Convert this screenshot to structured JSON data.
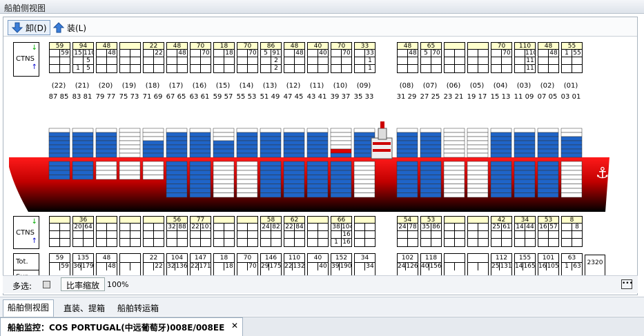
{
  "window": {
    "title": "船舶侧视图"
  },
  "toolbar": {
    "discharge_label": "卸(D)",
    "load_label": "装(L)"
  },
  "side": {
    "ctns": "CTNS",
    "tot": "Tot.",
    "sur": "Sur."
  },
  "bay_labels": [
    {
      "num": "(22)",
      "pair": "87 85"
    },
    {
      "num": "(21)",
      "pair": "83 81"
    },
    {
      "num": "(20)",
      "pair": "79 77"
    },
    {
      "num": "(19)",
      "pair": "75 73"
    },
    {
      "num": "(18)",
      "pair": "71 69"
    },
    {
      "num": "(17)",
      "pair": "67 65"
    },
    {
      "num": "(16)",
      "pair": "63 61"
    },
    {
      "num": "(15)",
      "pair": "59 57"
    },
    {
      "num": "(14)",
      "pair": "55 53"
    },
    {
      "num": "(13)",
      "pair": "51 49"
    },
    {
      "num": "(12)",
      "pair": "47 45"
    },
    {
      "num": "(11)",
      "pair": "43 41"
    },
    {
      "num": "(10)",
      "pair": "39 37"
    },
    {
      "num": "(09)",
      "pair": "35 33"
    },
    {
      "num": "(08)",
      "pair": "31 29"
    },
    {
      "num": "(07)",
      "pair": "27 25"
    },
    {
      "num": "(06)",
      "pair": "23 21"
    },
    {
      "num": "(05)",
      "pair": "19 17"
    },
    {
      "num": "(04)",
      "pair": "15 13"
    },
    {
      "num": "(03)",
      "pair": "11 09"
    },
    {
      "num": "(02)",
      "pair": "07 05"
    },
    {
      "num": "(01)",
      "pair": "03 01"
    }
  ],
  "deck_cells": [
    {
      "h": "59",
      "r": [
        [
          "",
          "59"
        ],
        [
          "",
          ""
        ],
        [
          "",
          ""
        ]
      ]
    },
    {
      "h": "94",
      "r": [
        [
          "15",
          "110"
        ],
        [
          "",
          "5"
        ],
        [
          "1",
          "5"
        ]
      ]
    },
    {
      "h": "48",
      "r": [
        [
          "",
          "48"
        ],
        [
          "",
          ""
        ],
        [
          "",
          ""
        ]
      ]
    },
    {
      "h": "",
      "r": [
        [
          "",
          ""
        ],
        [
          "",
          ""
        ],
        [
          "",
          ""
        ]
      ]
    },
    {
      "h": "22",
      "r": [
        [
          "",
          "22"
        ],
        [
          "",
          ""
        ],
        [
          "",
          ""
        ]
      ]
    },
    {
      "h": "48",
      "r": [
        [
          "",
          "48"
        ],
        [
          "",
          ""
        ],
        [
          "",
          ""
        ]
      ]
    },
    {
      "h": "70",
      "r": [
        [
          "",
          "70"
        ],
        [
          "",
          ""
        ],
        [
          "",
          ""
        ]
      ]
    },
    {
      "h": "18",
      "r": [
        [
          "",
          "18"
        ],
        [
          "",
          ""
        ],
        [
          "",
          ""
        ]
      ]
    },
    {
      "h": "70",
      "r": [
        [
          "",
          "70"
        ],
        [
          "",
          ""
        ],
        [
          "",
          ""
        ]
      ]
    },
    {
      "h": "86",
      "r": [
        [
          "5",
          "91"
        ],
        [
          "",
          "2"
        ],
        [
          "",
          "2"
        ]
      ]
    },
    {
      "h": "48",
      "r": [
        [
          "",
          "48"
        ],
        [
          "",
          ""
        ],
        [
          "",
          ""
        ]
      ]
    },
    {
      "h": "40",
      "r": [
        [
          "",
          "40"
        ],
        [
          "",
          ""
        ],
        [
          "",
          ""
        ]
      ]
    },
    {
      "h": "70",
      "r": [
        [
          "",
          "70"
        ],
        [
          "",
          ""
        ],
        [
          "",
          ""
        ]
      ]
    },
    {
      "h": "33",
      "r": [
        [
          "",
          "33"
        ],
        [
          "",
          "1"
        ],
        [
          "",
          "1"
        ]
      ]
    },
    {
      "h": "48",
      "r": [
        [
          "",
          "48"
        ],
        [
          "",
          ""
        ],
        [
          "",
          ""
        ]
      ]
    },
    {
      "h": "65",
      "r": [
        [
          "5",
          "70"
        ],
        [
          "",
          ""
        ],
        [
          "",
          ""
        ]
      ]
    },
    {
      "h": "",
      "r": [
        [
          "",
          ""
        ],
        [
          "",
          ""
        ],
        [
          "",
          ""
        ]
      ]
    },
    {
      "h": "",
      "r": [
        [
          "",
          ""
        ],
        [
          "",
          ""
        ],
        [
          "",
          ""
        ]
      ]
    },
    {
      "h": "70",
      "r": [
        [
          "",
          "70"
        ],
        [
          "",
          ""
        ],
        [
          "",
          ""
        ]
      ]
    },
    {
      "h": "110",
      "r": [
        [
          "",
          "110"
        ],
        [
          "",
          "11"
        ],
        [
          "",
          "11"
        ]
      ]
    },
    {
      "h": "48",
      "r": [
        [
          "",
          "48"
        ],
        [
          "",
          ""
        ],
        [
          "",
          ""
        ]
      ]
    },
    {
      "h": "55",
      "r": [
        [
          "1",
          "55"
        ],
        [
          "",
          ""
        ],
        [
          "",
          ""
        ]
      ]
    }
  ],
  "hold_cells": [
    {
      "h": "",
      "r": [
        [
          "",
          ""
        ],
        [
          "",
          ""
        ],
        [
          "",
          ""
        ]
      ]
    },
    {
      "h": "36",
      "r": [
        [
          "20",
          "64"
        ],
        [
          "",
          ""
        ],
        [
          "",
          ""
        ]
      ]
    },
    {
      "h": "",
      "r": [
        [
          "",
          ""
        ],
        [
          "",
          ""
        ],
        [
          "",
          ""
        ]
      ]
    },
    {
      "h": "",
      "r": [
        [
          "",
          ""
        ],
        [
          "",
          ""
        ],
        [
          "",
          ""
        ]
      ]
    },
    {
      "h": "",
      "r": [
        [
          "",
          ""
        ],
        [
          "",
          ""
        ],
        [
          "",
          ""
        ]
      ]
    },
    {
      "h": "56",
      "r": [
        [
          "32",
          "88"
        ],
        [
          "",
          ""
        ],
        [
          "",
          ""
        ]
      ]
    },
    {
      "h": "77",
      "r": [
        [
          "22",
          "101"
        ],
        [
          "",
          ""
        ],
        [
          "",
          ""
        ]
      ]
    },
    {
      "h": "",
      "r": [
        [
          "",
          ""
        ],
        [
          "",
          ""
        ],
        [
          "",
          ""
        ]
      ]
    },
    {
      "h": "",
      "r": [
        [
          "",
          ""
        ],
        [
          "",
          ""
        ],
        [
          "",
          ""
        ]
      ]
    },
    {
      "h": "58",
      "r": [
        [
          "24",
          "82"
        ],
        [
          "",
          ""
        ],
        [
          "",
          ""
        ]
      ]
    },
    {
      "h": "62",
      "r": [
        [
          "22",
          "84"
        ],
        [
          "",
          ""
        ],
        [
          "",
          ""
        ]
      ]
    },
    {
      "h": "",
      "r": [
        [
          "",
          ""
        ],
        [
          "",
          ""
        ],
        [
          "",
          ""
        ]
      ]
    },
    {
      "h": "66",
      "r": [
        [
          "38",
          "104"
        ],
        [
          "",
          "16"
        ],
        [
          "1",
          "16"
        ]
      ]
    },
    {
      "h": "",
      "r": [
        [
          "",
          ""
        ],
        [
          "",
          ""
        ],
        [
          "",
          ""
        ]
      ]
    },
    {
      "h": "54",
      "r": [
        [
          "24",
          "78"
        ],
        [
          "",
          ""
        ],
        [
          "",
          ""
        ]
      ]
    },
    {
      "h": "53",
      "r": [
        [
          "35",
          "86"
        ],
        [
          "",
          ""
        ],
        [
          "",
          ""
        ]
      ]
    },
    {
      "h": "",
      "r": [
        [
          "",
          ""
        ],
        [
          "",
          ""
        ],
        [
          "",
          ""
        ]
      ]
    },
    {
      "h": "",
      "r": [
        [
          "",
          ""
        ],
        [
          "",
          ""
        ],
        [
          "",
          ""
        ]
      ]
    },
    {
      "h": "42",
      "r": [
        [
          "25",
          "61"
        ],
        [
          "",
          ""
        ],
        [
          "",
          ""
        ]
      ]
    },
    {
      "h": "34",
      "r": [
        [
          "14",
          "44"
        ],
        [
          "",
          ""
        ],
        [
          "",
          ""
        ]
      ]
    },
    {
      "h": "53",
      "r": [
        [
          "16",
          "57"
        ],
        [
          "",
          ""
        ],
        [
          "",
          ""
        ]
      ]
    },
    {
      "h": "8",
      "r": [
        [
          "",
          "8"
        ],
        [
          "",
          ""
        ],
        [
          "",
          ""
        ]
      ]
    }
  ],
  "totals": [
    {
      "t": "59",
      "a": "",
      "b": "59"
    },
    {
      "t": "135",
      "a": "36",
      "b": "179"
    },
    {
      "t": "48",
      "a": "",
      "b": "48"
    },
    {
      "t": "",
      "a": "",
      "b": ""
    },
    {
      "t": "22",
      "a": "",
      "b": "22"
    },
    {
      "t": "104",
      "a": "32",
      "b": "136"
    },
    {
      "t": "147",
      "a": "22",
      "b": "171"
    },
    {
      "t": "18",
      "a": "",
      "b": "18"
    },
    {
      "t": "70",
      "a": "",
      "b": "70"
    },
    {
      "t": "146",
      "a": "29",
      "b": "175"
    },
    {
      "t": "110",
      "a": "22",
      "b": "132"
    },
    {
      "t": "40",
      "a": "",
      "b": "40"
    },
    {
      "t": "152",
      "a": "39",
      "b": "190"
    },
    {
      "t": "34",
      "a": "",
      "b": "34"
    },
    {
      "t": "102",
      "a": "24",
      "b": "126"
    },
    {
      "t": "118",
      "a": "40",
      "b": "156"
    },
    {
      "t": "",
      "a": "",
      "b": ""
    },
    {
      "t": "",
      "a": "",
      "b": ""
    },
    {
      "t": "112",
      "a": "25",
      "b": "131"
    },
    {
      "t": "155",
      "a": "14",
      "b": "165"
    },
    {
      "t": "101",
      "a": "16",
      "b": "105"
    },
    {
      "t": "63",
      "a": "1",
      "b": "63"
    }
  ],
  "grand_total": "2320",
  "status": {
    "multi_select": "多选:",
    "zoom_button": "比率缩放",
    "zoom_value": "100%"
  },
  "tabs": [
    "船舶侧视图",
    "直装、提箱",
    "船舶转运箱"
  ],
  "document_tab": "船舶监控：COS PORTUGAL(中远葡萄牙)008E/008EE",
  "colors": {
    "loaded": "#1f64c8",
    "empty_slot": "#ffffff",
    "hull_red": "#d40000",
    "header_yellow": "#ffffcc"
  }
}
